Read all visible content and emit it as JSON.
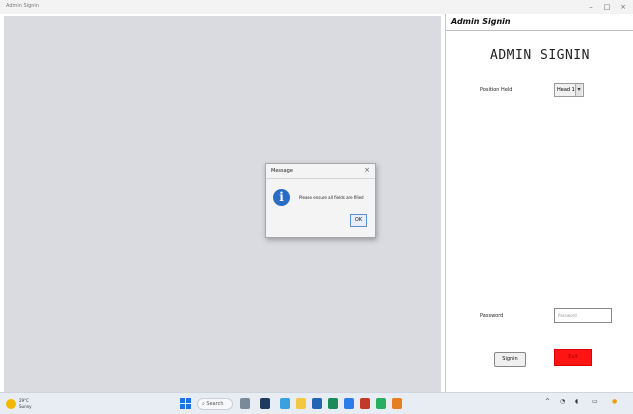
{
  "window": {
    "title": "Admin Signin",
    "controls": {
      "minimize": "–",
      "maximize": "□",
      "close": "×"
    }
  },
  "panel": {
    "header": "Admin Signin",
    "title": "ADMIN SIGNIN",
    "position_label": "Position Held",
    "position_value": "Head 1",
    "password_label": "Password",
    "password_placeholder": "Password",
    "signin_button": "Signin",
    "exit_button": "Exit",
    "accent_color": "#ff1414"
  },
  "dialog": {
    "title": "Message",
    "close": "×",
    "message": "Please ensure all fields are filled",
    "ok": "OK",
    "icon": "info-icon"
  },
  "taskbar": {
    "weather_temp": "29°C",
    "weather_desc": "Sunny",
    "search_label": "Search",
    "icons": [
      "start-icon",
      "search-icon",
      "widgets-icon",
      "file-explorer-icon",
      "browser-icon",
      "store-icon",
      "mail-icon",
      "app-icon"
    ]
  }
}
